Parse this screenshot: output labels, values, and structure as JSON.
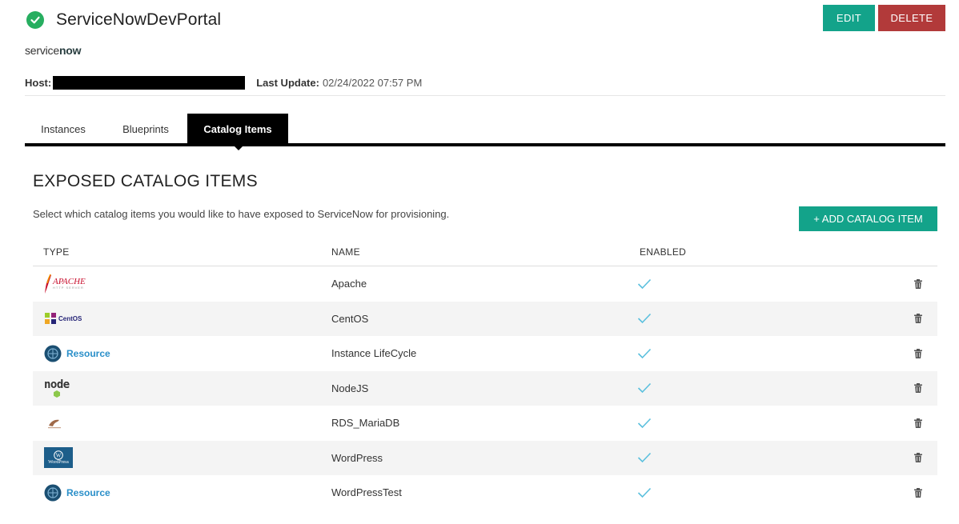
{
  "header": {
    "title": "ServiceNowDevPortal",
    "edit_label": "EDIT",
    "delete_label": "DELETE",
    "status_color": "#27ae60"
  },
  "logo": {
    "part1": "service",
    "part2": "now"
  },
  "host": {
    "label": "Host:",
    "last_update_label": "Last Update:",
    "last_update_value": "02/24/2022 07:57 PM"
  },
  "tabs": [
    {
      "label": "Instances"
    },
    {
      "label": "Blueprints"
    },
    {
      "label": "Catalog Items",
      "active": true
    }
  ],
  "section": {
    "title": "EXPOSED CATALOG ITEMS",
    "description": "Select which catalog items you would like to have exposed to ServiceNow for provisioning.",
    "add_label": "+ ADD CATALOG ITEM"
  },
  "table": {
    "columns": [
      "TYPE",
      "NAME",
      "ENABLED"
    ],
    "rows": [
      {
        "type_icon": "apache-logo",
        "type_label": "APACHE",
        "name": "Apache",
        "enabled": true
      },
      {
        "type_icon": "centos-logo",
        "type_label": "CentOS",
        "name": "CentOS",
        "enabled": true
      },
      {
        "type_icon": "resource-logo",
        "type_label": "Resource",
        "name": "Instance LifeCycle",
        "enabled": true
      },
      {
        "type_icon": "nodejs-logo",
        "type_label": "node",
        "name": "NodeJS",
        "enabled": true
      },
      {
        "type_icon": "mariadb-logo",
        "type_label": "",
        "name": "RDS_MariaDB",
        "enabled": true
      },
      {
        "type_icon": "wordpress-logo",
        "type_label": "WordPress",
        "name": "WordPress",
        "enabled": true
      },
      {
        "type_icon": "resource-logo",
        "type_label": "Resource",
        "name": "WordPressTest",
        "enabled": true
      }
    ]
  },
  "colors": {
    "accent": "#13a38a",
    "danger": "#b23a3a",
    "check": "#5bc0de"
  }
}
